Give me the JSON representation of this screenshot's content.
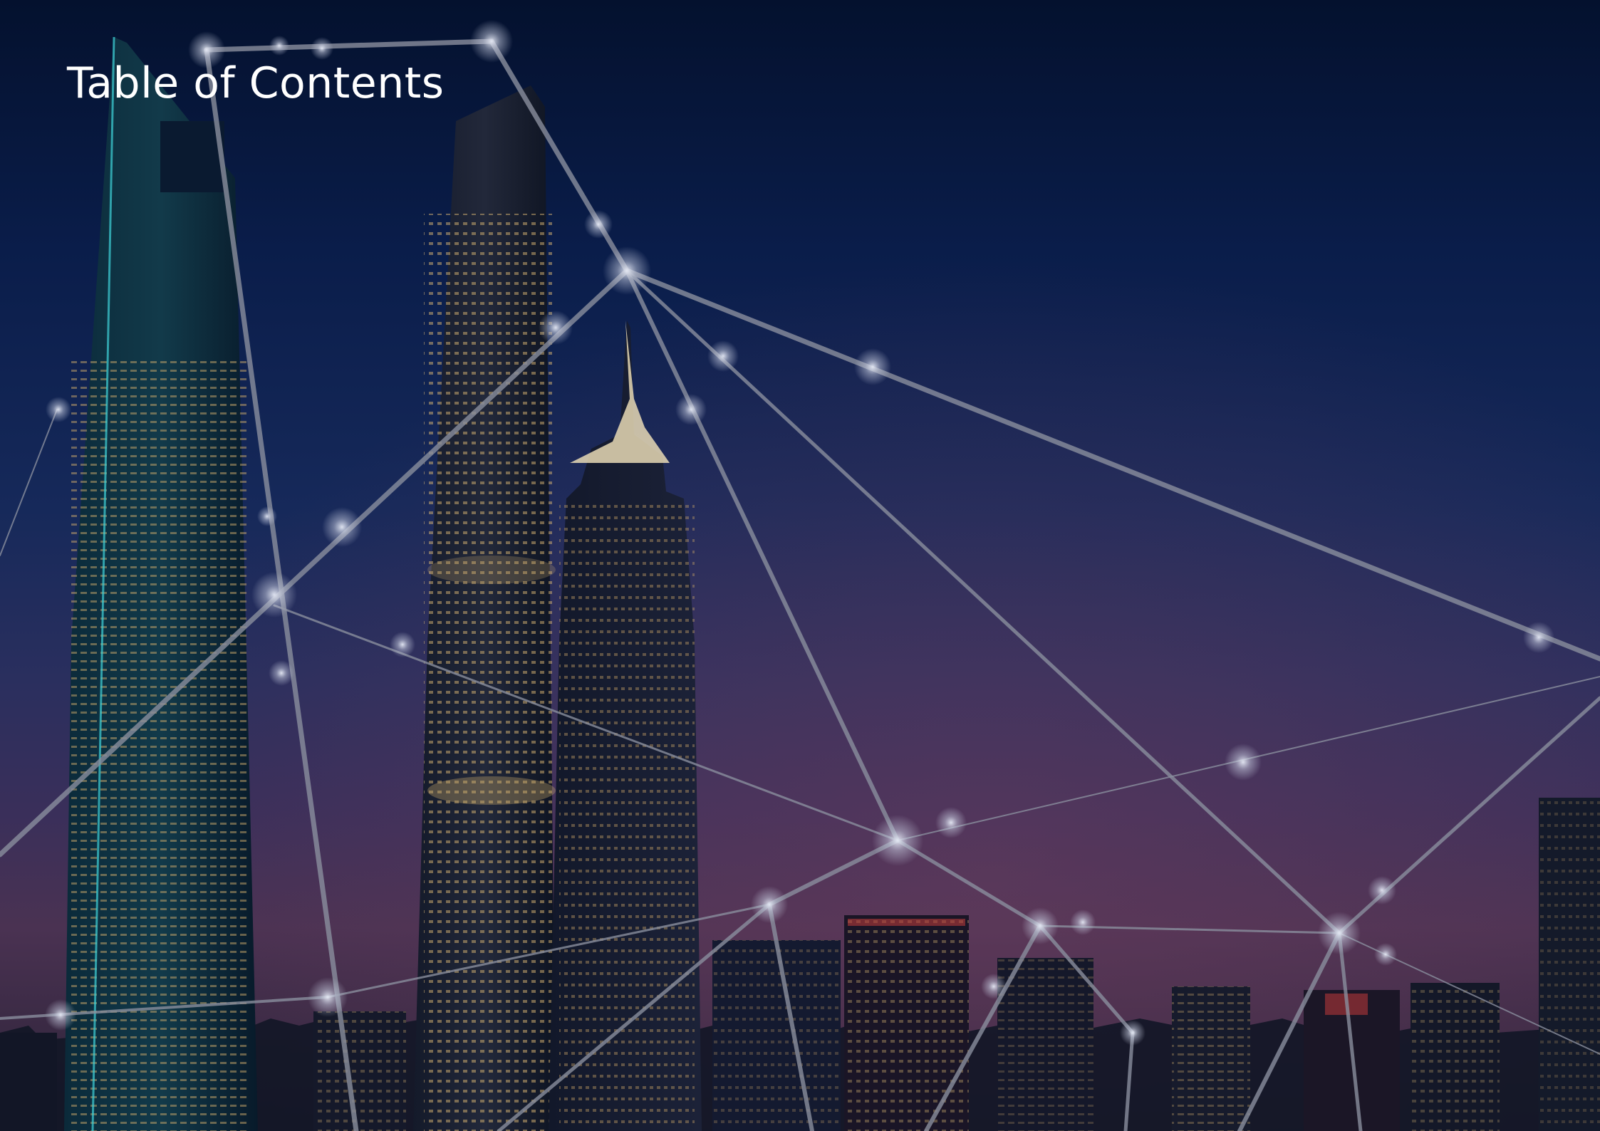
{
  "page": {
    "title": "Table of  Contents"
  },
  "colors": {
    "sky_top": "#04112e",
    "sky_mid": "#16295a",
    "sky_horizon": "#4a3252",
    "network_line": "#8a8f9e",
    "node_glow": "#cfd4e6",
    "title_text": "#ffffff"
  }
}
